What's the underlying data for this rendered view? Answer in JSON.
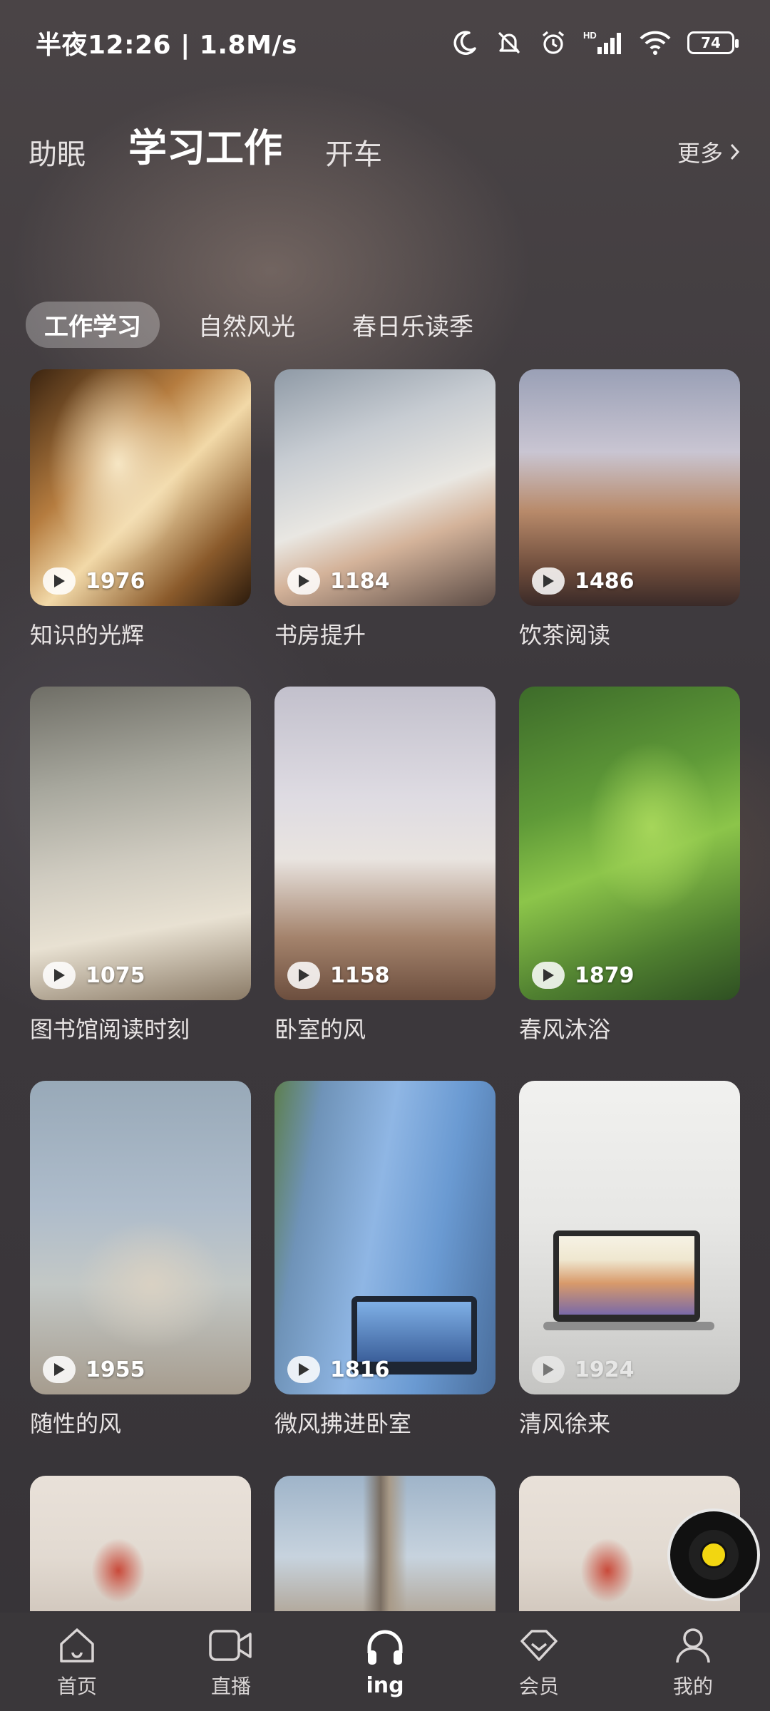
{
  "status_bar": {
    "time_text": "半夜12:26 | 1.8M/s",
    "battery": "74",
    "icons": [
      "moon-icon",
      "bell-off-icon",
      "alarm-icon",
      "signal-hd-icon",
      "wifi-icon",
      "battery-icon"
    ]
  },
  "top_tabs": [
    {
      "label": "助眠",
      "active": false
    },
    {
      "label": "学习工作",
      "active": true
    },
    {
      "label": "开车",
      "active": false
    }
  ],
  "more_label": "更多",
  "sub_tabs": [
    {
      "label": "工作学习",
      "active": true
    },
    {
      "label": "自然风光",
      "active": false
    },
    {
      "label": "春日乐读季",
      "active": false
    }
  ],
  "cards": [
    {
      "title": "知识的光辉",
      "count": "1976"
    },
    {
      "title": "书房提升",
      "count": "1184"
    },
    {
      "title": "饮茶阅读",
      "count": "1486"
    },
    {
      "title": "图书馆阅读时刻",
      "count": "1075"
    },
    {
      "title": "卧室的风",
      "count": "1158"
    },
    {
      "title": "春风沐浴",
      "count": "1879"
    },
    {
      "title": "随性的风",
      "count": "1955"
    },
    {
      "title": "微风拂进卧室",
      "count": "1816"
    },
    {
      "title": "清风徐来",
      "count": "1924"
    }
  ],
  "bottom_nav": [
    {
      "label": "首页",
      "icon": "home-icon",
      "active": false
    },
    {
      "label": "直播",
      "icon": "video-camera-icon",
      "active": false
    },
    {
      "label": "ing",
      "icon": "headphones-icon",
      "active": true
    },
    {
      "label": "会员",
      "icon": "diamond-icon",
      "active": false
    },
    {
      "label": "我的",
      "icon": "user-icon",
      "active": false
    }
  ],
  "colors": {
    "accent_yellow": "#f2d611",
    "background": "#3f3b40"
  }
}
